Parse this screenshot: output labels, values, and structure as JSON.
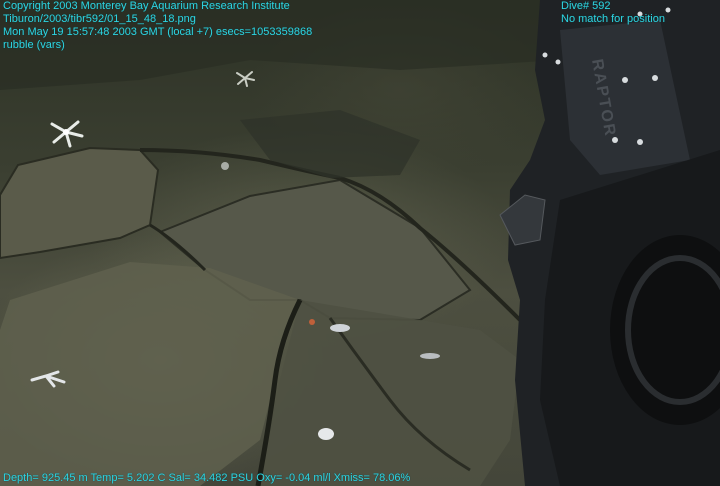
{
  "overlay": {
    "top_left": [
      "Copyright 2003 Monterey Bay Aquarium Research Institute",
      "Tiburon/2003/tibr592/01_15_48_18.png",
      "Mon May 19 15:57:48 2003 GMT (local +7)  esecs=1053359868",
      "rubble (vars)"
    ],
    "top_right": [
      "Dive# 592",
      "No match for position"
    ],
    "bottom": "Depth= 925.45 m  Temp= 5.202 C  Sal= 34.482 PSU  Oxy= -0.04 ml/l  Xmiss= 78.06%"
  },
  "vehicle_label": "RAPTOR",
  "colors": {
    "overlay_text": "#2fd4e0",
    "seafloor": "#4d4f40",
    "vehicle": "#1f2225"
  }
}
